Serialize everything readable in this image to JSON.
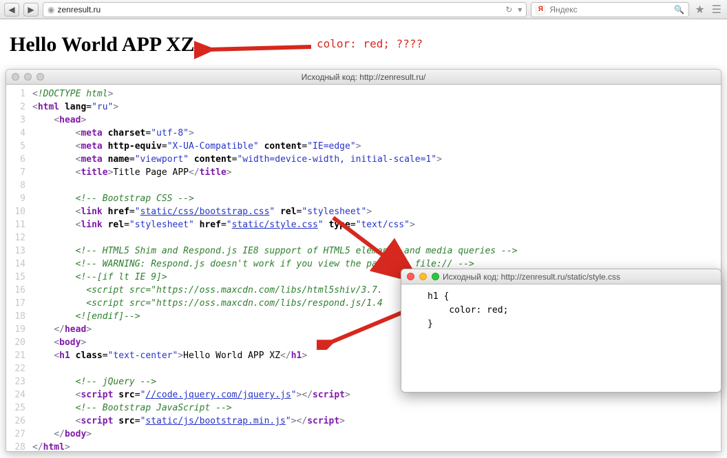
{
  "browser": {
    "url": "zenresult.ru",
    "search_placeholder": "Яндекс"
  },
  "page_heading": "Hello World APP XZ",
  "annotation": "color: red; ????",
  "source_window": {
    "title": "Исходный код: http://zenresult.ru/",
    "lines": [
      {
        "n": 1,
        "html": "<span class='c-pun'>&lt;</span><span class='c-doctype'>!DOCTYPE html</span><span class='c-pun'>&gt;</span>"
      },
      {
        "n": 2,
        "html": "<span class='c-pun'>&lt;</span><span class='c-tag'>html</span> <span class='c-attr'>lang</span>=<span class='c-str'>\"ru\"</span><span class='c-pun'>&gt;</span>"
      },
      {
        "n": 3,
        "html": "    <span class='c-pun'>&lt;</span><span class='c-tag'>head</span><span class='c-pun'>&gt;</span>"
      },
      {
        "n": 4,
        "html": "        <span class='c-pun'>&lt;</span><span class='c-tag'>meta</span> <span class='c-attr'>charset</span>=<span class='c-str'>\"utf-8\"</span><span class='c-pun'>&gt;</span>"
      },
      {
        "n": 5,
        "html": "        <span class='c-pun'>&lt;</span><span class='c-tag'>meta</span> <span class='c-attr'>http-equiv</span>=<span class='c-str'>\"X-UA-Compatible\"</span> <span class='c-attr'>content</span>=<span class='c-str'>\"IE=edge\"</span><span class='c-pun'>&gt;</span>"
      },
      {
        "n": 6,
        "html": "        <span class='c-pun'>&lt;</span><span class='c-tag'>meta</span> <span class='c-attr'>name</span>=<span class='c-str'>\"viewport\"</span> <span class='c-attr'>content</span>=<span class='c-str'>\"width=device-width, initial-scale=1\"</span><span class='c-pun'>&gt;</span>"
      },
      {
        "n": 7,
        "html": "        <span class='c-pun'>&lt;</span><span class='c-tag'>title</span><span class='c-pun'>&gt;</span><span class='c-txt'>Title Page APP</span><span class='c-pun'>&lt;/</span><span class='c-tag'>title</span><span class='c-pun'>&gt;</span>"
      },
      {
        "n": 8,
        "html": ""
      },
      {
        "n": 9,
        "html": "        <span class='c-cmt'>&lt;!-- Bootstrap CSS --&gt;</span>"
      },
      {
        "n": 10,
        "html": "        <span class='c-pun'>&lt;</span><span class='c-tag'>link</span> <span class='c-attr'>href</span>=<span class='c-str'>\"</span><span class='c-link'>static/css/bootstrap.css</span><span class='c-str'>\"</span> <span class='c-attr'>rel</span>=<span class='c-str'>\"stylesheet\"</span><span class='c-pun'>&gt;</span>"
      },
      {
        "n": 11,
        "html": "        <span class='c-pun'>&lt;</span><span class='c-tag'>link</span> <span class='c-attr'>rel</span>=<span class='c-str'>\"stylesheet\"</span> <span class='c-attr'>href</span>=<span class='c-str'>\"</span><span class='c-link'>static/style.css</span><span class='c-str'>\"</span> <span class='c-attr'>type</span>=<span class='c-str'>\"text/css\"</span><span class='c-pun'>&gt;</span>"
      },
      {
        "n": 12,
        "html": ""
      },
      {
        "n": 13,
        "html": "        <span class='c-cmt'>&lt;!-- HTML5 Shim and Respond.js IE8 support of HTML5 elements and media queries --&gt;</span>"
      },
      {
        "n": 14,
        "html": "        <span class='c-cmt'>&lt;!-- WARNING: Respond.js doesn't work if you view the page via file:// --&gt;</span>"
      },
      {
        "n": 15,
        "html": "        <span class='c-cmt'>&lt;!--[if lt IE 9]&gt;</span>"
      },
      {
        "n": 16,
        "html": "          <span class='c-cmt'>&lt;script src=\"https://oss.maxcdn.com/libs/html5shiv/3.7.</span>"
      },
      {
        "n": 17,
        "html": "          <span class='c-cmt'>&lt;script src=\"https://oss.maxcdn.com/libs/respond.js/1.4</span>"
      },
      {
        "n": 18,
        "html": "        <span class='c-cmt'>&lt;![endif]--&gt;</span>"
      },
      {
        "n": 19,
        "html": "    <span class='c-pun'>&lt;/</span><span class='c-tag'>head</span><span class='c-pun'>&gt;</span>"
      },
      {
        "n": 20,
        "html": "    <span class='c-pun'>&lt;</span><span class='c-tag'>body</span><span class='c-pun'>&gt;</span>"
      },
      {
        "n": 21,
        "html": "    <span class='c-pun'>&lt;</span><span class='c-tag'>h1</span> <span class='c-attr'>class</span>=<span class='c-str'>\"text-center\"</span><span class='c-pun'>&gt;</span><span class='c-txt'>Hello World APP XZ</span><span class='c-pun'>&lt;/</span><span class='c-tag'>h1</span><span class='c-pun'>&gt;</span>"
      },
      {
        "n": 22,
        "html": ""
      },
      {
        "n": 23,
        "html": "        <span class='c-cmt'>&lt;!-- jQuery --&gt;</span>"
      },
      {
        "n": 24,
        "html": "        <span class='c-pun'>&lt;</span><span class='c-tag'>script</span> <span class='c-attr'>src</span>=<span class='c-str'>\"</span><span class='c-link'>//code.jquery.com/jquery.js</span><span class='c-str'>\"</span><span class='c-pun'>&gt;&lt;/</span><span class='c-tag'>script</span><span class='c-pun'>&gt;</span>"
      },
      {
        "n": 25,
        "html": "        <span class='c-cmt'>&lt;!-- Bootstrap JavaScript --&gt;</span>"
      },
      {
        "n": 26,
        "html": "        <span class='c-pun'>&lt;</span><span class='c-tag'>script</span> <span class='c-attr'>src</span>=<span class='c-str'>\"</span><span class='c-link'>static/js/bootstrap.min.js</span><span class='c-str'>\"</span><span class='c-pun'>&gt;&lt;/</span><span class='c-tag'>script</span><span class='c-pun'>&gt;</span>"
      },
      {
        "n": 27,
        "html": "    <span class='c-pun'>&lt;/</span><span class='c-tag'>body</span><span class='c-pun'>&gt;</span>"
      },
      {
        "n": 28,
        "html": "<span class='c-pun'>&lt;/</span><span class='c-tag'>html</span><span class='c-pun'>&gt;</span>"
      }
    ]
  },
  "popup": {
    "title": "Исходный код: http://zenresult.ru/static/style.css",
    "content": "h1 {\n    color: red;\n}"
  }
}
